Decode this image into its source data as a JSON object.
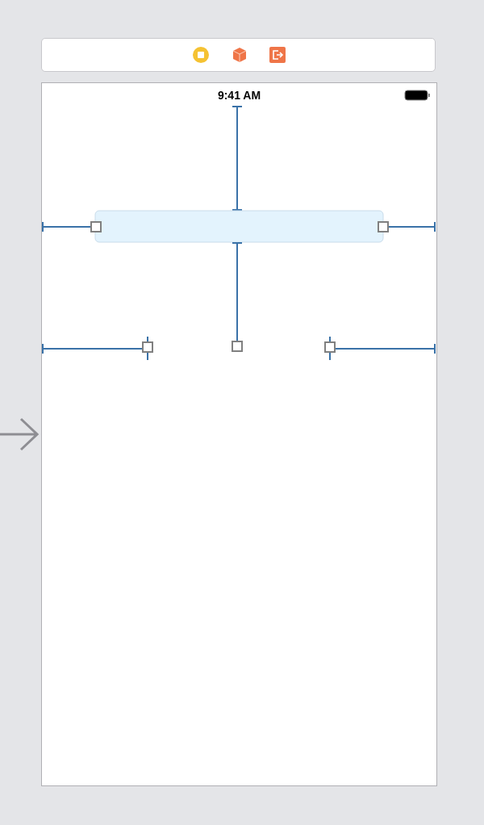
{
  "status_bar": {
    "time": "9:41 AM"
  },
  "text_field": {
    "selected": true
  }
}
